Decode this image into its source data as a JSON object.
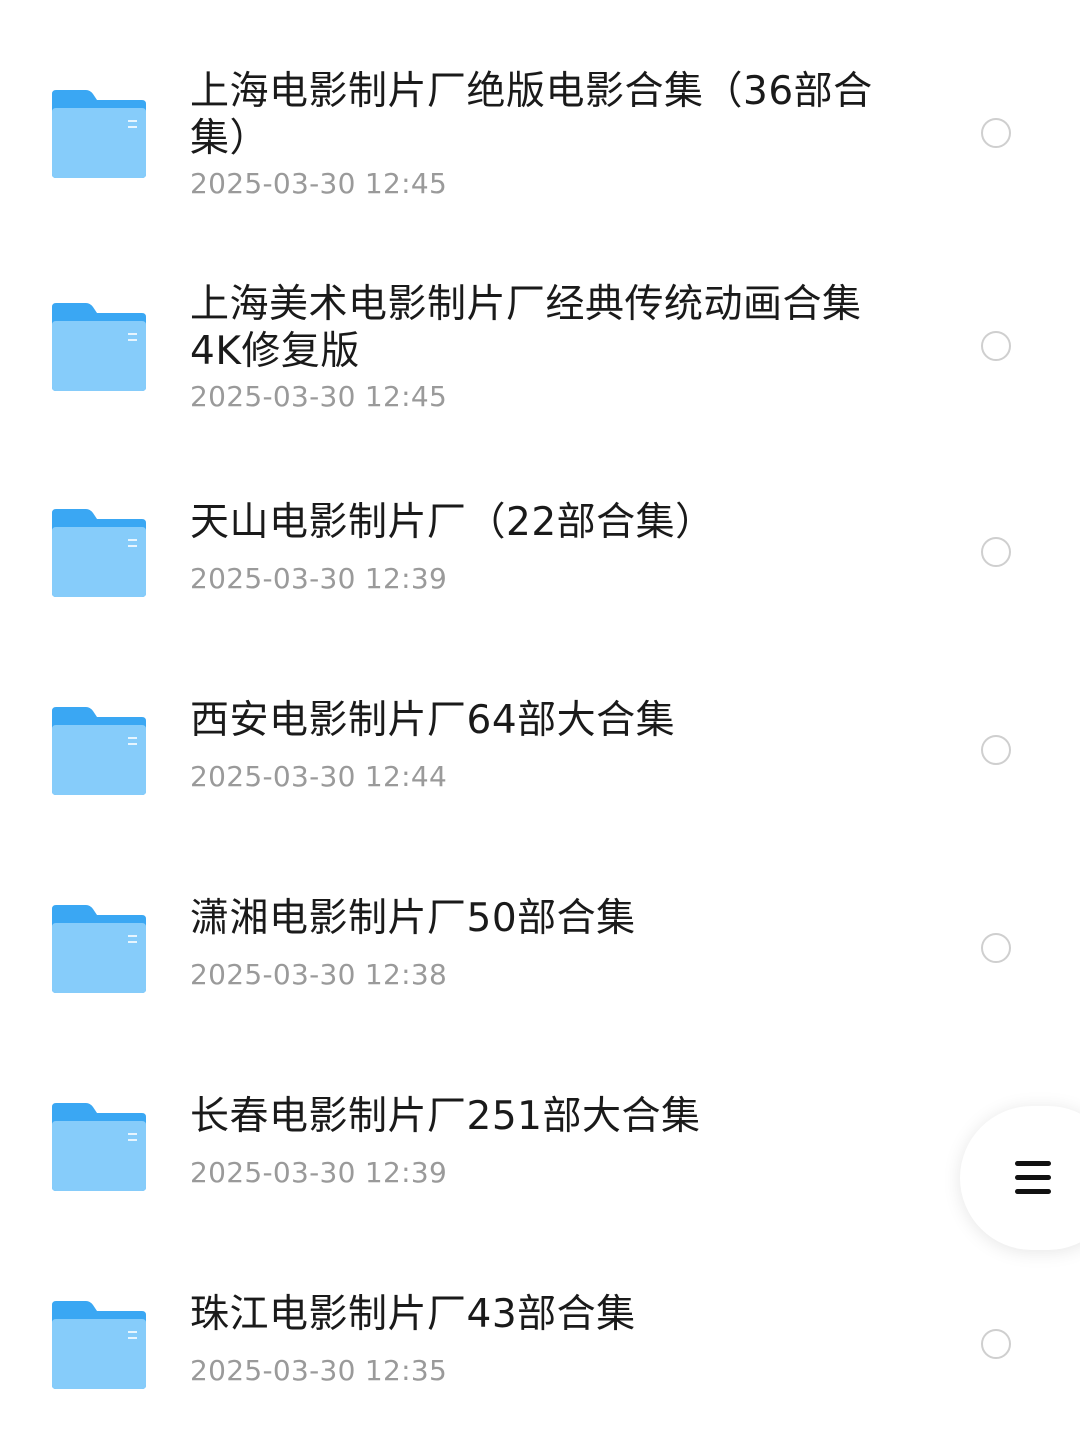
{
  "colors": {
    "folder_back": "#3aa7f3",
    "folder_front": "#86ccfa",
    "title_text": "#1a1a1a",
    "date_text": "#9a9a9a",
    "radio_border": "#cfcfcf"
  },
  "files": [
    {
      "name": "上海电影制片厂绝版电影合集（36部合集）",
      "date": "2025-03-30 12:45",
      "icon": "folder-icon"
    },
    {
      "name": "上海美术电影制片厂经典传统动画合集 4K修复版",
      "date": "2025-03-30 12:45",
      "icon": "folder-icon"
    },
    {
      "name": "天山电影制片厂（22部合集）",
      "date": "2025-03-30 12:39",
      "icon": "folder-icon"
    },
    {
      "name": "西安电影制片厂64部大合集",
      "date": "2025-03-30 12:44",
      "icon": "folder-icon"
    },
    {
      "name": "潇湘电影制片厂50部合集",
      "date": "2025-03-30 12:38",
      "icon": "folder-icon"
    },
    {
      "name": "长春电影制片厂251部大合集",
      "date": "2025-03-30 12:39",
      "icon": "folder-icon"
    },
    {
      "name": "珠江电影制片厂43部合集",
      "date": "2025-03-30 12:35",
      "icon": "folder-icon"
    }
  ],
  "floating_button": {
    "icon": "menu-icon"
  }
}
